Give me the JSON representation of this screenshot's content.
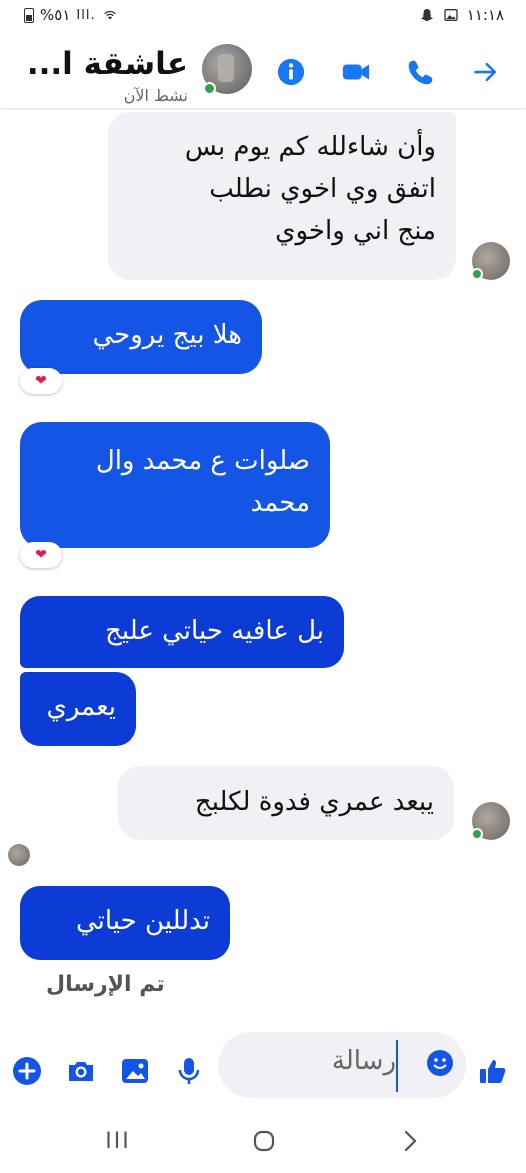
{
  "status_bar": {
    "battery_text": "%٥١",
    "signal_text": "Ill.",
    "time": "١١:١٨"
  },
  "header": {
    "contact_name": "عاشقة ا...",
    "contact_status": "نشط الآن",
    "icons": [
      "info-icon",
      "video-call-icon",
      "phone-icon",
      "arrow-right-icon"
    ]
  },
  "messages": [
    {
      "direction": "incoming",
      "text": "وأن شاءلله كم يوم بس\nاتفق وي اخوي نطلب\nمنج اني واخوي"
    },
    {
      "direction": "outgoing",
      "text": "هلا بيج يروحي",
      "reaction": "❤"
    },
    {
      "direction": "outgoing",
      "text": "صلوات ع محمد وال\nمحمد",
      "reaction": "❤"
    },
    {
      "direction": "outgoing",
      "text": "بل عافيه حياتي عليج"
    },
    {
      "direction": "outgoing",
      "text": "يعمري"
    },
    {
      "direction": "incoming",
      "text": "يبعد عمري فدوة لكلبج"
    },
    {
      "direction": "outgoing",
      "text": "تدللين حياتي"
    }
  ],
  "sent_status": "تم الإرسال",
  "composer": {
    "placeholder": "رسالة",
    "icons": [
      "plus-icon",
      "camera-icon",
      "gallery-icon",
      "microphone-icon",
      "emoji-icon",
      "like-icon"
    ]
  },
  "nav": {
    "recent_label": "III",
    "home_label": "○",
    "back_label": "〉"
  },
  "colors": {
    "accent": "#1877f2",
    "outgoing_bubble": "#1455e6",
    "outgoing_bubble_dark": "#0c3bd6",
    "incoming_bubble": "#f0f0f5",
    "online": "#31a24c"
  }
}
